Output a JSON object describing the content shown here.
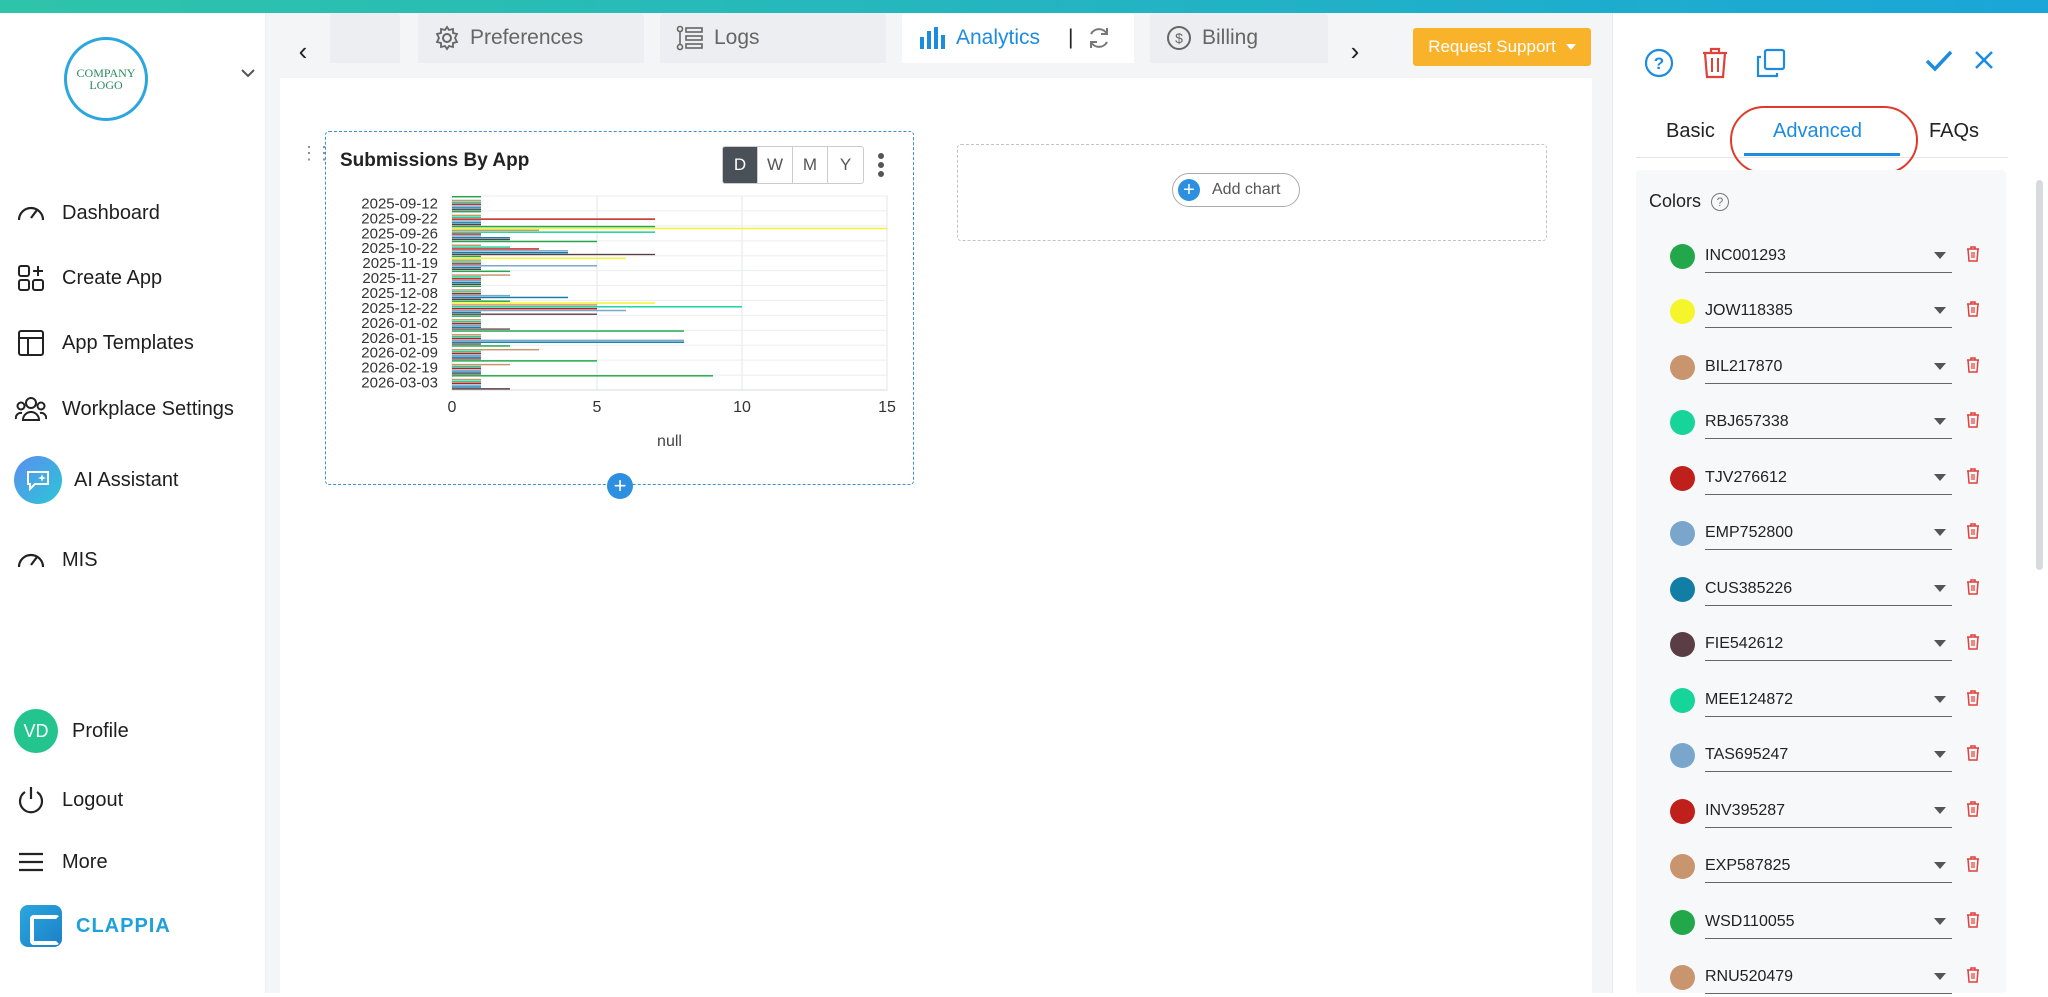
{
  "brand": {
    "logo_text": "COMPANY LOGO",
    "name": "CLAPPIA",
    "accent": "#1d8ce0"
  },
  "sidebar": {
    "items": [
      {
        "label": "Dashboard",
        "icon": "gauge-icon"
      },
      {
        "label": "Create App",
        "icon": "grid-plus-icon"
      },
      {
        "label": "App Templates",
        "icon": "template-icon"
      },
      {
        "label": "Workplace Settings",
        "icon": "users-icon"
      },
      {
        "label": "AI Assistant",
        "icon": "ai-chat-icon"
      },
      {
        "label": "MIS",
        "icon": "gauge-icon"
      }
    ],
    "profile": {
      "initials": "VD",
      "label": "Profile"
    },
    "logout": "Logout",
    "more": "More"
  },
  "tabs": [
    {
      "label": "",
      "icon": ""
    },
    {
      "label": "Preferences",
      "icon": "gear-icon"
    },
    {
      "label": "Logs",
      "icon": "logs-icon"
    },
    {
      "label": "Analytics",
      "icon": "bar-chart-icon",
      "active": true
    },
    {
      "label": "Billing",
      "icon": "dollar-icon"
    }
  ],
  "request_support": "Request Support",
  "chart_card": {
    "title": "Submissions By App",
    "periods": [
      "D",
      "W",
      "M",
      "Y"
    ],
    "active_period": "D"
  },
  "add_chart_label": "Add chart",
  "chart_data": {
    "type": "bar",
    "orientation": "horizontal",
    "stacked": false,
    "title": "Submissions By App",
    "xlabel": "null",
    "xlim": [
      0,
      15
    ],
    "x_ticks": [
      0,
      5,
      10,
      15
    ],
    "y_tick_labels": [
      "2025-09-12",
      "2025-09-22",
      "2025-09-26",
      "2025-10-22",
      "2025-11-19",
      "2025-11-27",
      "2025-12-08",
      "2025-12-22",
      "2026-01-02",
      "2026-01-15",
      "2026-02-09",
      "2026-02-19",
      "2026-03-03"
    ],
    "grid": true,
    "categories": [
      "2025-09-12",
      "2025-09-22",
      "2025-09-26",
      "2025-10-22",
      "2025-11-19",
      "2025-11-27",
      "2025-12-08",
      "2025-12-22",
      "2026-01-02",
      "2026-01-15",
      "2026-02-09",
      "2026-02-19",
      "2026-03-03"
    ],
    "series": [
      {
        "color": "#22a84a",
        "values": [
          1,
          1,
          7,
          5,
          1,
          2,
          1,
          2,
          1,
          8,
          2,
          5,
          9
        ]
      },
      {
        "color": "#f5f52c",
        "values": [
          0,
          0,
          15,
          0,
          6,
          0,
          0,
          7,
          0,
          0,
          0,
          0,
          0
        ]
      },
      {
        "color": "#c8956e",
        "values": [
          1,
          1,
          3,
          1,
          1,
          2,
          1,
          5,
          1,
          1,
          3,
          2,
          1
        ]
      },
      {
        "color": "#16d49a",
        "values": [
          1,
          1,
          7,
          2,
          1,
          1,
          1,
          10,
          1,
          1,
          1,
          1,
          1
        ]
      },
      {
        "color": "#c0201b",
        "values": [
          1,
          7,
          1,
          3,
          1,
          1,
          1,
          5,
          1,
          1,
          1,
          1,
          1
        ]
      },
      {
        "color": "#7aa6cc",
        "values": [
          1,
          1,
          1,
          4,
          5,
          1,
          2,
          6,
          1,
          8,
          1,
          1,
          1
        ]
      },
      {
        "color": "#127ea6",
        "values": [
          1,
          1,
          2,
          4,
          1,
          1,
          4,
          1,
          1,
          8,
          1,
          1,
          1
        ]
      },
      {
        "color": "#5a3d45",
        "values": [
          1,
          1,
          2,
          7,
          1,
          1,
          1,
          5,
          2,
          1,
          1,
          1,
          2
        ]
      }
    ]
  },
  "panel": {
    "tabs": [
      "Basic",
      "Advanced",
      "FAQs"
    ],
    "active_tab": "Advanced",
    "colors_title": "Colors",
    "colors": [
      {
        "code": "INC001293",
        "color": "#22a84a"
      },
      {
        "code": "JOW118385",
        "color": "#f5f52c"
      },
      {
        "code": "BIL217870",
        "color": "#c8956e"
      },
      {
        "code": "RBJ657338",
        "color": "#16d49a"
      },
      {
        "code": "TJV276612",
        "color": "#c0201b"
      },
      {
        "code": "EMP752800",
        "color": "#7aa6cc"
      },
      {
        "code": "CUS385226",
        "color": "#127ea6"
      },
      {
        "code": "FIE542612",
        "color": "#5a3d45"
      },
      {
        "code": "MEE124872",
        "color": "#16d49a"
      },
      {
        "code": "TAS695247",
        "color": "#7aa6cc"
      },
      {
        "code": "INV395287",
        "color": "#c0201b"
      },
      {
        "code": "EXP587825",
        "color": "#c8956e"
      },
      {
        "code": "WSD110055",
        "color": "#22a84a"
      },
      {
        "code": "RNU520479",
        "color": "#c8956e"
      }
    ]
  }
}
